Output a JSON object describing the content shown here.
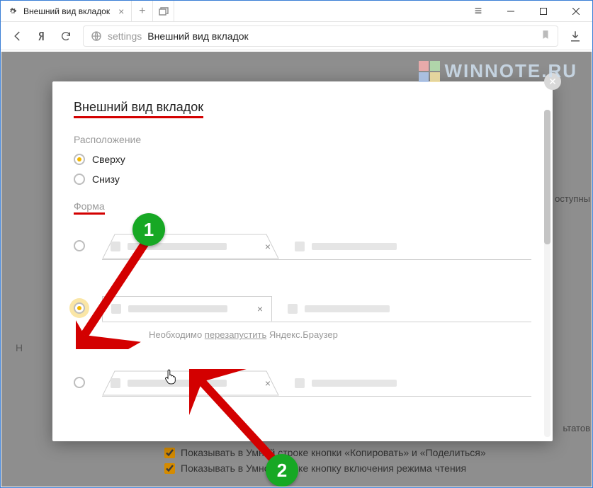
{
  "window": {
    "tab_title": "Внешний вид вкладок",
    "new_tab": "+",
    "menu": "≡"
  },
  "toolbar": {
    "address_prefix": "settings",
    "address_text": "Внешний вид вкладок"
  },
  "dialog": {
    "title": "Внешний вид вкладок",
    "section_position": "Расположение",
    "option_top": "Сверху",
    "option_bottom": "Снизу",
    "section_shape": "Форма",
    "restart_prefix": "Необходимо ",
    "restart_link": "перезапустить",
    "restart_suffix": " Яндекс.Браузер"
  },
  "background": {
    "letter": "Н",
    "check1": "Показывать в Умной строке кнопки «Копировать» и «Поделиться»",
    "check2": "Показывать в Умной строке кнопку включения режима чтения",
    "hint_right_1": "оступны",
    "hint_right_2": "ьтатов"
  },
  "annotations": {
    "badge1": "1",
    "badge2": "2"
  },
  "watermark": {
    "text": "WINNOTE.RU"
  }
}
